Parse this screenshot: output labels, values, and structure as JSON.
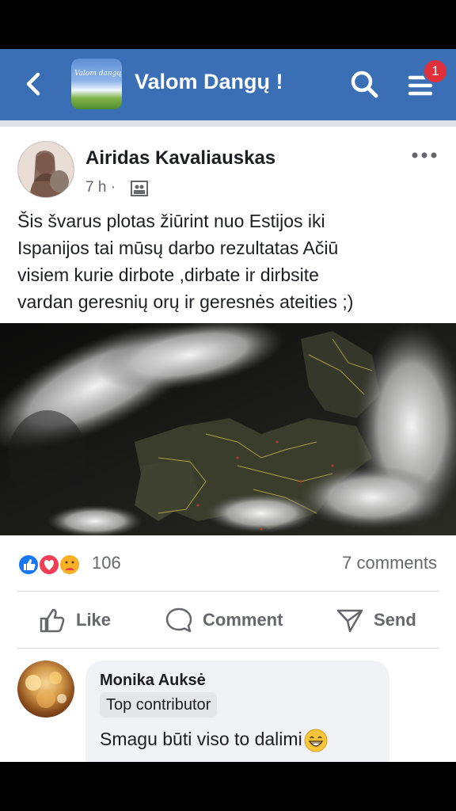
{
  "header": {
    "group_title": "Valom Dangų !",
    "thumb_text": "Valom dangų",
    "notification_count": "1",
    "icons": [
      "back-arrow-icon",
      "search-icon",
      "menu-icon"
    ],
    "color": "#3a6fb6"
  },
  "post": {
    "author": "Airidas Kavaliauskas",
    "time": "7 h ·",
    "privacy_icon": "group-privacy-icon",
    "text": "Šis švarus plotas žiūrint nuo Estijos iki\nIspanijos tai mūsų darbo rezultatas Ačiū\nvisiem kurie dirbote ,dirbate ir dirbsite\nvardan geresnių orų ir geresnės ateities ;)",
    "image": "satellite-map-europe-clouds"
  },
  "engagement": {
    "reactions": [
      "like",
      "love",
      "care"
    ],
    "reaction_count": "106",
    "comments_count": "7 comments"
  },
  "actions": {
    "like": "Like",
    "comment": "Comment",
    "send": "Send"
  },
  "comment": {
    "name": "Monika Auksė",
    "badge": "Top contributor",
    "text": "Smagu būti viso to dalimi",
    "emoji": "grinning-face-icon"
  }
}
